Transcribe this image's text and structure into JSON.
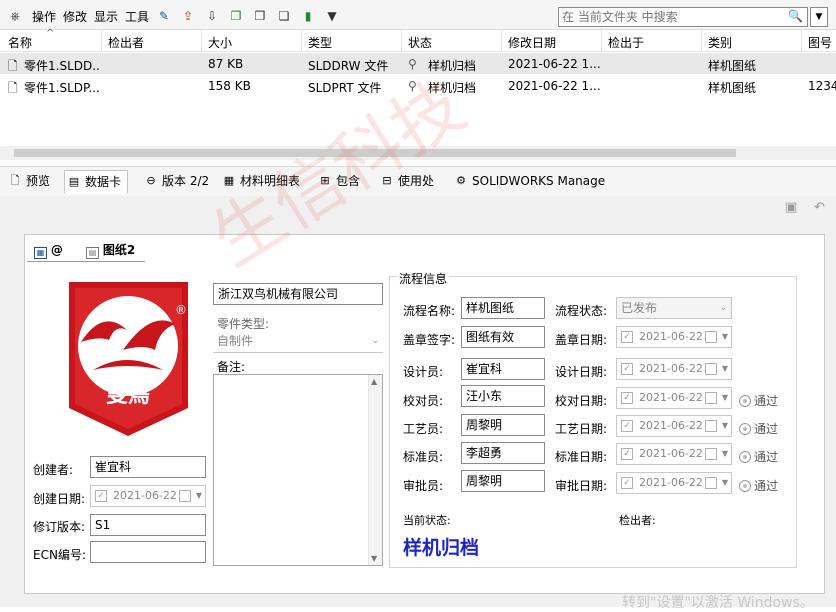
{
  "toolbar": {
    "menu": [
      "操作",
      "修改",
      "显示",
      "工具"
    ],
    "search_placeholder": "在 当前文件夹 中搜索"
  },
  "list": {
    "columns": [
      "名称",
      "检出者",
      "大小",
      "类型",
      "状态",
      "修改日期",
      "检出于",
      "类别",
      "图号"
    ],
    "rows": [
      {
        "name": "零件1.SLDD...",
        "checked_by": "",
        "size": "87 KB",
        "type": "SLDDRW 文件",
        "state": "样机归档",
        "modified": "2021-06-22 1...",
        "checked_at": "",
        "category": "样机图纸",
        "drawing_no": ""
      },
      {
        "name": "零件1.SLDP...",
        "checked_by": "",
        "size": "158 KB",
        "type": "SLDPRT 文件",
        "state": "样机归档",
        "modified": "2021-06-22 1...",
        "checked_at": "",
        "category": "样机图纸",
        "drawing_no": "1234"
      }
    ]
  },
  "tabs": {
    "preview": "预览",
    "datacard": "数据卡",
    "version": "版本 2/2",
    "bom": "材料明细表",
    "contains": "包含",
    "where_used": "使用处",
    "manage": "SOLIDWORKS Manage"
  },
  "card": {
    "tab_at": "@",
    "tab_drawing": "图纸2",
    "company": "浙江双鸟机械有限公司",
    "part_type_label": "零件类型:",
    "part_type_value": "自制件",
    "remark_label": "备注:",
    "creator_label": "创建者:",
    "creator_value": "崔宜科",
    "created_date_label": "创建日期:",
    "created_date_value": "2021-06-22",
    "revision_label": "修订版本:",
    "revision_value": "S1",
    "ecn_label": "ECN编号:",
    "ecn_value": "",
    "flow": {
      "title": "流程信息",
      "flow_name_label": "流程名称:",
      "flow_name_value": "样机图纸",
      "flow_state_label": "流程状态:",
      "flow_state_value": "已发布",
      "stamp_label": "盖章签字:",
      "stamp_value": "图纸有效",
      "stamp_date_label": "盖章日期:",
      "stamp_date_value": "2021-06-22",
      "designer_label": "设计员:",
      "designer_value": "崔宜科",
      "design_date_label": "设计日期:",
      "design_date_value": "2021-06-22",
      "checker_label": "校对员:",
      "checker_value": "汪小东",
      "check_date_label": "校对日期:",
      "check_date_value": "2021-06-22",
      "process_label": "工艺员:",
      "process_value": "周黎明",
      "process_date_label": "工艺日期:",
      "process_date_value": "2021-06-22",
      "standard_label": "标准员:",
      "standard_value": "李超勇",
      "standard_date_label": "标准日期:",
      "standard_date_value": "2021-06-22",
      "approver_label": "审批员:",
      "approver_value": "周黎明",
      "approve_date_label": "审批日期:",
      "approve_date_value": "2021-06-22",
      "pass_label": "通过",
      "current_state_label": "当前状态:",
      "current_state_value": "样机归档",
      "checked_out_label": "检出者:"
    },
    "logo_text": "雙鳥"
  },
  "watermark": "生信科技",
  "os_watermark": "转到\"设置\"以激活 Windows。",
  "colors": {
    "logo_red": "#c8151b",
    "state_blue": "#1f23c8"
  }
}
